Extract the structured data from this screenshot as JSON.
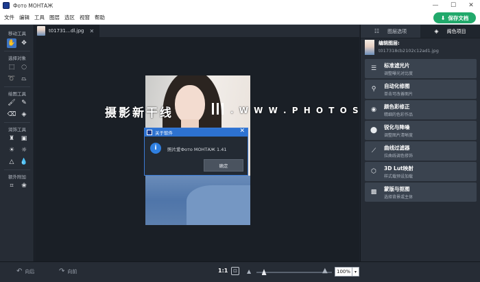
{
  "app": {
    "title": "Фото МОНТАЖ"
  },
  "window_controls": {
    "minimize": "—",
    "maximize": "☐",
    "close": "✕"
  },
  "menu": [
    "文件",
    "编辑",
    "工具",
    "图层",
    "选区",
    "视窗",
    "帮助"
  ],
  "save_button": {
    "label": "保存文档",
    "icon": "save-icon"
  },
  "toolbar": {
    "sections": [
      {
        "label": "移动工具",
        "tools": [
          {
            "name": "hand-icon",
            "glyph": "✋",
            "active": true
          },
          {
            "name": "move-icon",
            "glyph": "✥",
            "active": false
          }
        ]
      },
      {
        "label": "选择对象",
        "tools": [
          {
            "name": "rect-select-icon",
            "glyph": "⬚",
            "active": false
          },
          {
            "name": "ellipse-select-icon",
            "glyph": "◌",
            "active": false
          },
          {
            "name": "lasso-icon",
            "glyph": "➰",
            "active": false
          },
          {
            "name": "polygon-lasso-icon",
            "glyph": "⏢",
            "active": false
          }
        ]
      },
      {
        "label": "绘图工具",
        "tools": [
          {
            "name": "brush-icon",
            "glyph": "🖌",
            "active": false
          },
          {
            "name": "pencil-icon",
            "glyph": "✎",
            "active": false
          },
          {
            "name": "eraser-icon",
            "glyph": "⌫",
            "active": false
          },
          {
            "name": "fill-bucket-icon",
            "glyph": "◈",
            "active": false
          }
        ]
      },
      {
        "label": "润饰工具",
        "tools": [
          {
            "name": "stamp-icon",
            "glyph": "♜",
            "active": false
          },
          {
            "name": "patch-icon",
            "glyph": "▣",
            "active": false
          },
          {
            "name": "dodge-icon",
            "glyph": "☀",
            "active": false
          },
          {
            "name": "burn-icon",
            "glyph": "☼",
            "active": false
          },
          {
            "name": "sharpen-icon",
            "glyph": "△",
            "active": false
          },
          {
            "name": "blur-icon",
            "glyph": "💧",
            "active": false
          }
        ]
      },
      {
        "label": "额外附加",
        "tools": [
          {
            "name": "crop-icon",
            "glyph": "⌗",
            "active": false
          },
          {
            "name": "shapes-icon",
            "glyph": "❀",
            "active": false
          }
        ]
      }
    ]
  },
  "document_tab": {
    "name": "t01731…dl.jpg",
    "close": "✕"
  },
  "watermark": {
    "text": "摄影新干线",
    "url": ". W W W . P H O T O S K S . V I P"
  },
  "dialog": {
    "title": "关于软件",
    "close": "✕",
    "info_glyph": "i",
    "message": "照片爱Фото МОНТАЖ 1.41",
    "ok_label": "确定"
  },
  "right_panel": {
    "tabs": [
      {
        "label": "图层选项",
        "icon": "sliders-icon",
        "active": false
      },
      {
        "label": "阁色项目",
        "icon": "layers-icon",
        "active": true
      }
    ],
    "layer": {
      "title": "编辑图层:",
      "file": "t017318cb2102c12ad1.jpg"
    },
    "features": [
      {
        "title": "标准滤光片",
        "subtitle": "调整曝光对比度",
        "icon": "sliders-icon",
        "glyph": "☰"
      },
      {
        "title": "自动化修图",
        "subtitle": "单击可改善图片",
        "icon": "magic-wand-icon",
        "glyph": "⚲"
      },
      {
        "title": "颜色彩修正",
        "subtitle": "精细的色彩作品",
        "icon": "palette-icon",
        "glyph": "◉"
      },
      {
        "title": "锐化与降噪",
        "subtitle": "调整图片清晰度",
        "icon": "drop-icon",
        "glyph": "⬤"
      },
      {
        "title": "曲线过滤器",
        "subtitle": "拉曲线调色修饰",
        "icon": "curve-icon",
        "glyph": "⟋"
      },
      {
        "title": "3D Lut映射",
        "subtitle": "样式载预设加载",
        "icon": "cube-icon",
        "glyph": "⬡"
      },
      {
        "title": "蒙版与抠图",
        "subtitle": "选择背景或主体",
        "icon": "mask-icon",
        "glyph": "▩"
      }
    ]
  },
  "bottom": {
    "undo": {
      "label": "向后",
      "glyph": "↶"
    },
    "redo": {
      "label": "向前",
      "glyph": "↷"
    },
    "ratio": "1:1",
    "fit_glyph": "⊡",
    "zoom_fraction": 0.1,
    "zoom_value": "100%",
    "zoom_caret": "▾"
  }
}
